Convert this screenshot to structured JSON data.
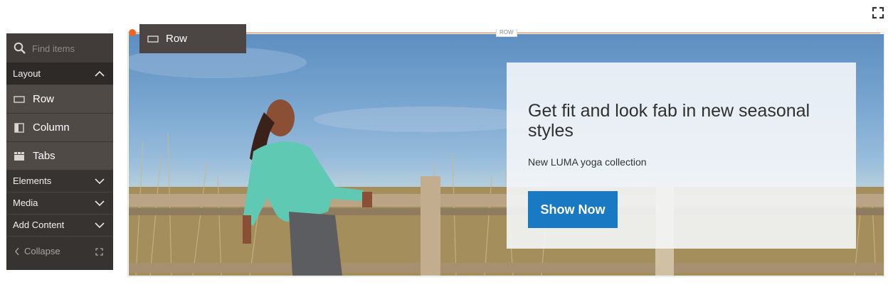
{
  "sidebar": {
    "search_placeholder": "Find items",
    "groups": [
      {
        "label": "Layout",
        "expanded": true
      },
      {
        "label": "Elements",
        "expanded": false
      },
      {
        "label": "Media",
        "expanded": false
      },
      {
        "label": "Add Content",
        "expanded": false
      }
    ],
    "layout_items": [
      {
        "label": "Row",
        "icon": "row-icon"
      },
      {
        "label": "Column",
        "icon": "column-icon"
      },
      {
        "label": "Tabs",
        "icon": "tabs-icon"
      }
    ],
    "collapse_label": "Collapse"
  },
  "stage": {
    "row_label": "Row",
    "row_tag": "ROW",
    "accent_color": "#f26322"
  },
  "banner": {
    "title": "Get fit and look fab in new seasonal styles",
    "subtitle": "New LUMA yoga collection",
    "button_label": "Show Now",
    "button_color": "#1979c3"
  }
}
